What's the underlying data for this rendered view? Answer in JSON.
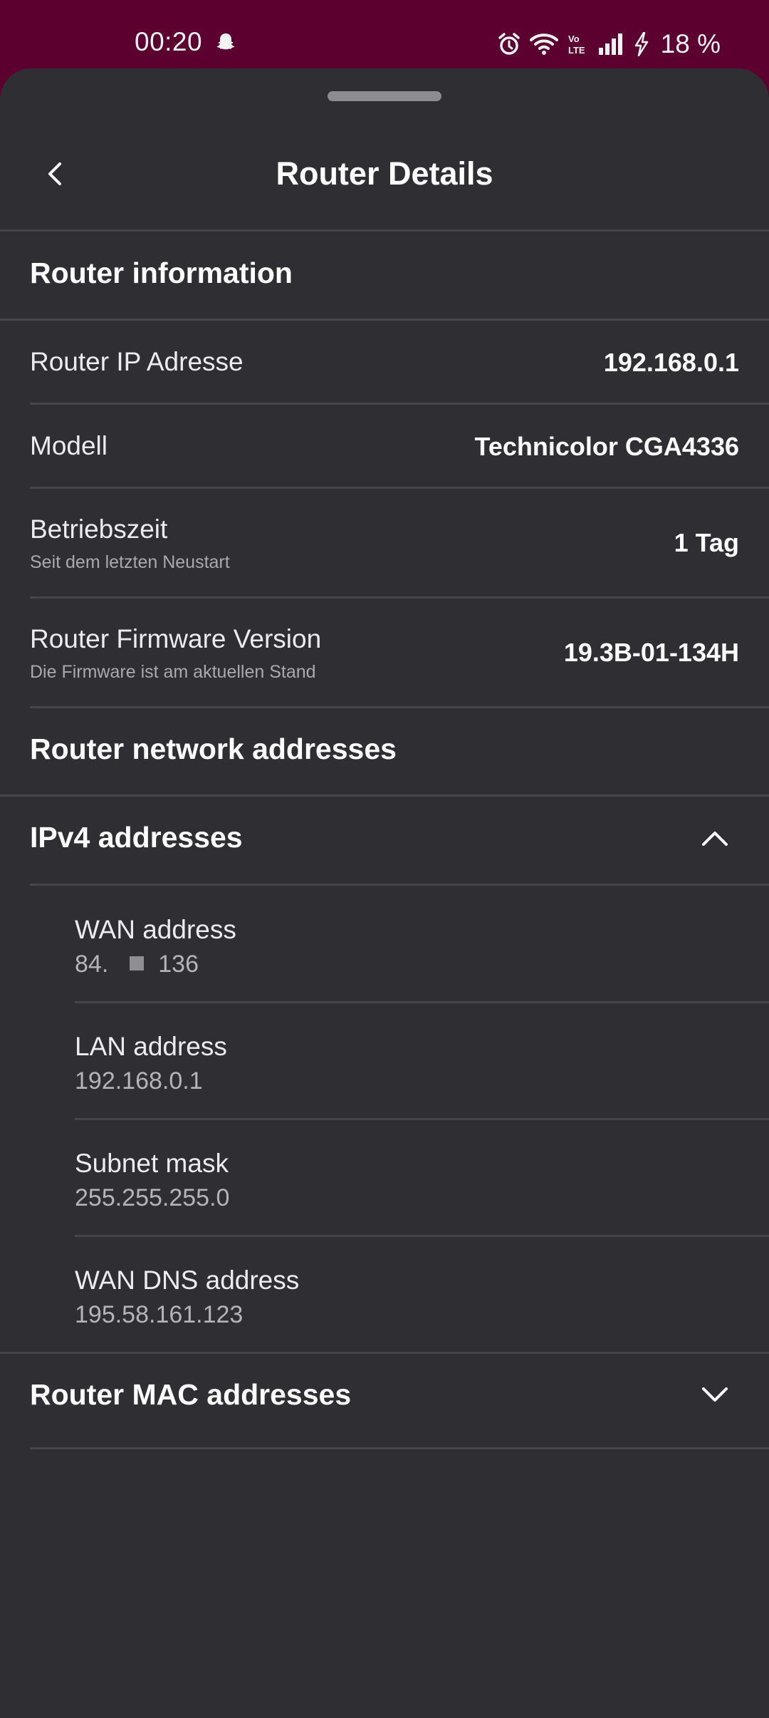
{
  "status_bar": {
    "time": "00:20",
    "battery": "18 %",
    "icons": [
      "snapchat-icon",
      "alarm-icon",
      "wifi-icon",
      "volte-icon",
      "signal-icon",
      "charging-icon"
    ]
  },
  "header": {
    "title": "Router Details",
    "back_icon": "back-arrow-icon"
  },
  "router_information": {
    "title": "Router information",
    "rows": [
      {
        "label": "Router IP Adresse",
        "sublabel": "",
        "value": "192.168.0.1"
      },
      {
        "label": "Modell",
        "sublabel": "",
        "value": "Technicolor CGA4336"
      },
      {
        "label": "Betriebszeit",
        "sublabel": "Seit dem letzten Neustart",
        "value": "1 Tag"
      },
      {
        "label": "Router Firmware Version",
        "sublabel": "Die Firmware ist am aktuellen Stand",
        "value": "19.3B-01-134H"
      }
    ]
  },
  "network_addresses": {
    "title": "Router network addresses",
    "ipv4": {
      "title": "IPv4 addresses",
      "expanded": true,
      "items": [
        {
          "label": "WAN address",
          "value_start": "84.",
          "value_end": "136"
        },
        {
          "label": "LAN address",
          "value": "192.168.0.1"
        },
        {
          "label": "Subnet mask",
          "value": "255.255.255.0"
        },
        {
          "label": "WAN DNS address",
          "value": "195.58.161.123"
        }
      ]
    },
    "mac": {
      "title": "Router MAC addresses",
      "expanded": false
    }
  },
  "colors": {
    "status_bar_bg": "#5c0030",
    "sheet_bg": "#2e2e33",
    "divider": "#45454b",
    "text_primary": "#ffffff",
    "text_secondary": "#a9a9ae"
  }
}
